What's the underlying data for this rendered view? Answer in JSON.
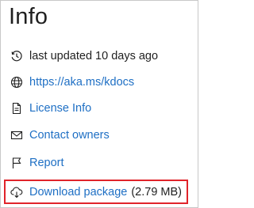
{
  "panel": {
    "title": "Info",
    "items": [
      {
        "icon": "history-icon",
        "label": "last updated 10 days ago",
        "link": false
      },
      {
        "icon": "globe-icon",
        "label": "https://aka.ms/kdocs",
        "link": true
      },
      {
        "icon": "document-icon",
        "label": "License Info",
        "link": true
      },
      {
        "icon": "mail-icon",
        "label": "Contact owners",
        "link": true
      },
      {
        "icon": "flag-icon",
        "label": "Report",
        "link": true
      },
      {
        "icon": "cloud-download-icon",
        "label": "Download package",
        "link": true,
        "size": "(2.79 MB)"
      }
    ]
  },
  "colors": {
    "link": "#1e6fc4",
    "text": "#1f1f1f",
    "highlight_border": "#e0232a",
    "panel_border": "#c8c8c8"
  }
}
